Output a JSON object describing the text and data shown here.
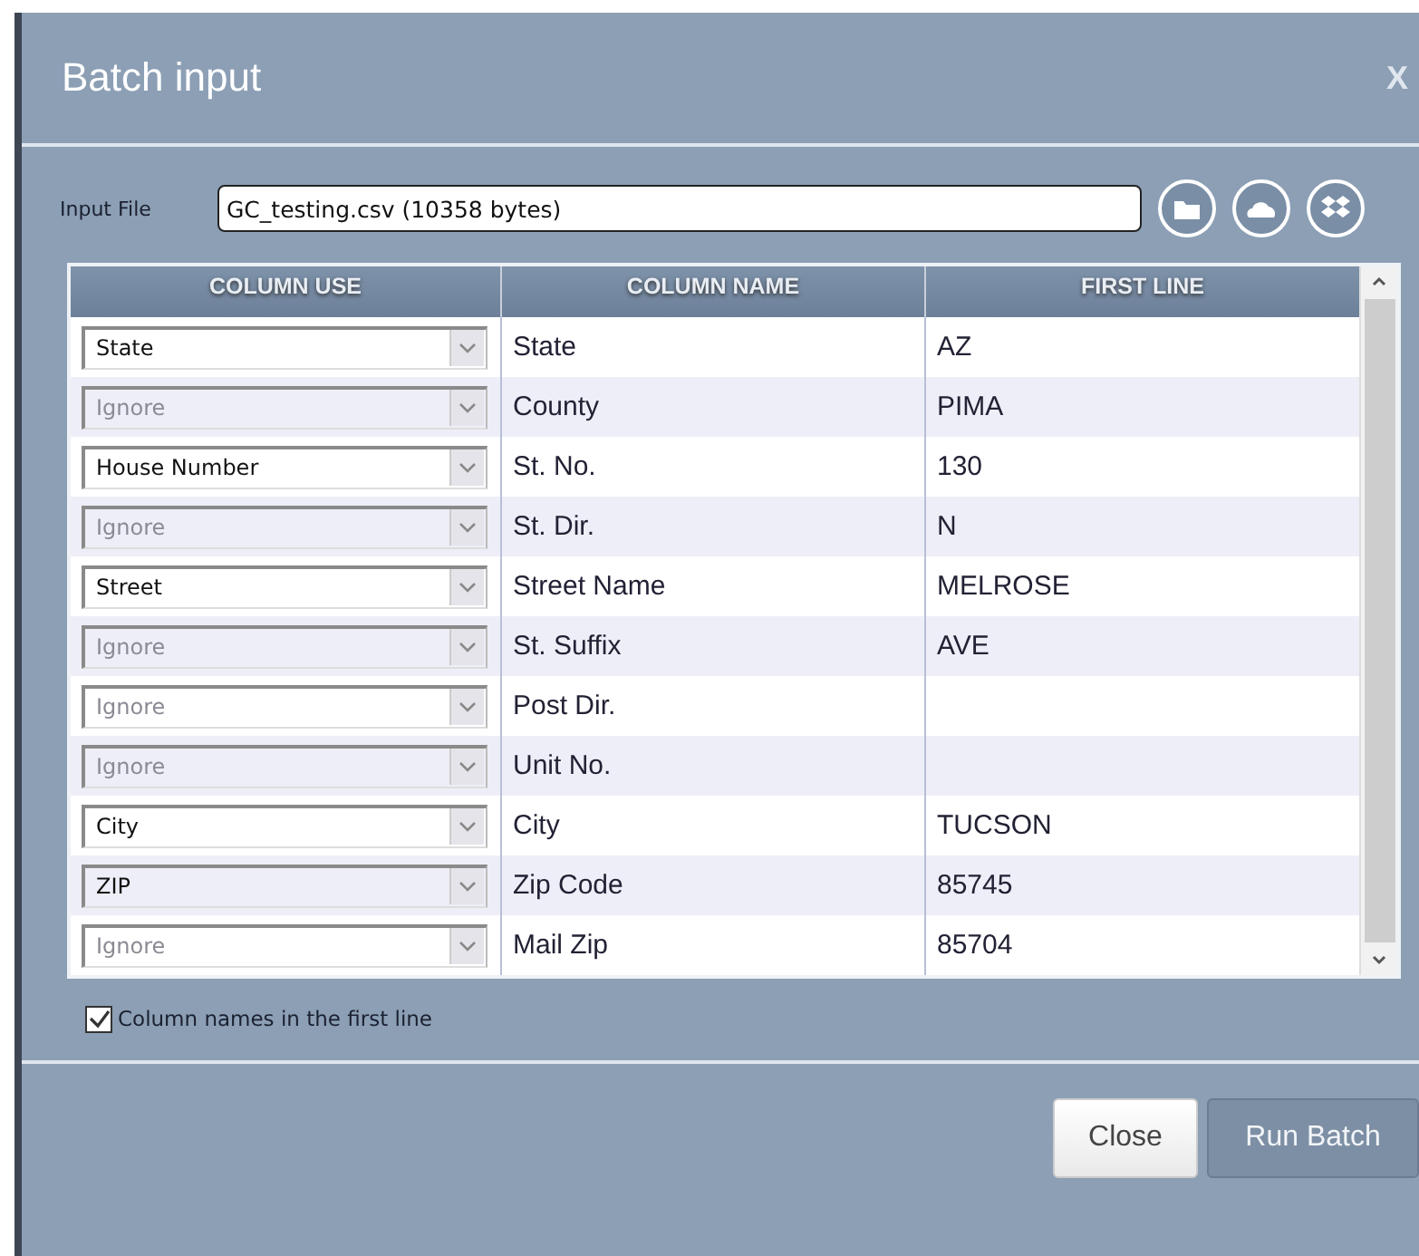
{
  "window": {
    "title": "Batch input",
    "close_glyph": "X"
  },
  "input_file": {
    "label": "Input File",
    "value": "GC_testing.csv (10358 bytes)"
  },
  "table": {
    "columns": [
      "COLUMN USE",
      "COLUMN NAME",
      "FIRST LINE"
    ],
    "rows": [
      {
        "use": "State",
        "ignored": false,
        "name": "State",
        "first_line": "AZ"
      },
      {
        "use": "Ignore",
        "ignored": true,
        "name": "County",
        "first_line": "PIMA"
      },
      {
        "use": "House Number",
        "ignored": false,
        "name": "St. No.",
        "first_line": "130"
      },
      {
        "use": "Ignore",
        "ignored": true,
        "name": "St. Dir.",
        "first_line": "N"
      },
      {
        "use": "Street",
        "ignored": false,
        "name": "Street Name",
        "first_line": "MELROSE"
      },
      {
        "use": "Ignore",
        "ignored": true,
        "name": "St. Suffix",
        "first_line": "AVE"
      },
      {
        "use": "Ignore",
        "ignored": true,
        "name": "Post Dir."
      },
      {
        "use": "Ignore",
        "ignored": true,
        "name": "Unit No."
      },
      {
        "use": "City",
        "ignored": false,
        "name": "City",
        "first_line": "TUCSON"
      },
      {
        "use": "ZIP",
        "ignored": false,
        "name": "Zip Code",
        "first_line": "85745"
      },
      {
        "use": "Ignore",
        "ignored": true,
        "name": "Mail Zip",
        "first_line": "85704"
      }
    ]
  },
  "header_checkbox": {
    "label": "Column names in the first line",
    "checked": true
  },
  "buttons": [
    {
      "label": "Close",
      "kind": "secondary"
    },
    {
      "label": "Run Batch",
      "kind": "primary"
    }
  ]
}
